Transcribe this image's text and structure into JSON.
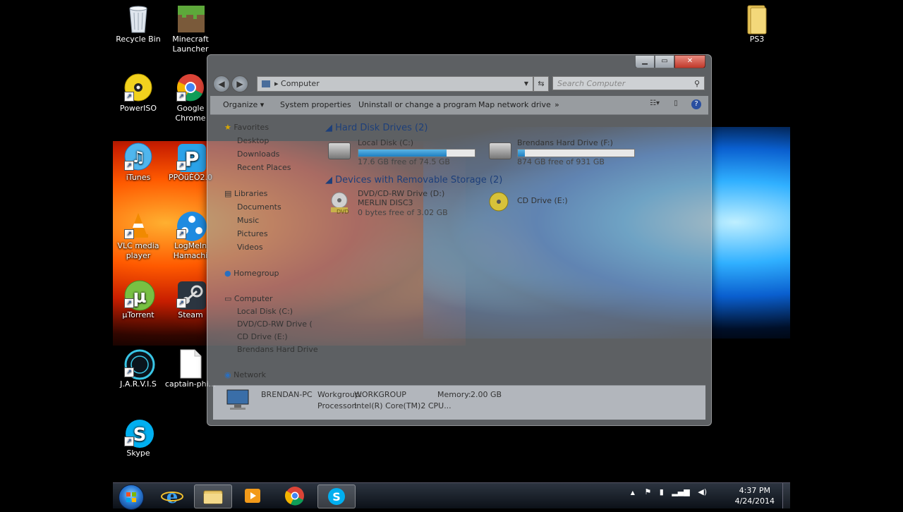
{
  "desktop": {
    "icons": [
      {
        "label": "Recycle Bin",
        "icon": "recycle-bin-icon"
      },
      {
        "label": "Minecraft Launcher",
        "icon": "minecraft-icon"
      },
      {
        "label": "PowerISO",
        "icon": "poweriso-icon"
      },
      {
        "label": "Google Chrome",
        "icon": "chrome-icon"
      },
      {
        "label": "iTunes",
        "icon": "itunes-icon"
      },
      {
        "label": "PPÒüÈÖ2.0",
        "icon": "pptv-icon"
      },
      {
        "label": "VLC media player",
        "icon": "vlc-icon"
      },
      {
        "label": "LogMeIn Hamachi",
        "icon": "hamachi-icon"
      },
      {
        "label": "µTorrent",
        "icon": "utorrent-icon"
      },
      {
        "label": "Steam",
        "icon": "steam-icon"
      },
      {
        "label": "J.A.R.V.I.S",
        "icon": "jarvis-icon"
      },
      {
        "label": "captain-phi...",
        "icon": "file-icon"
      },
      {
        "label": "Skype",
        "icon": "skype-icon"
      },
      {
        "label": "PS3",
        "icon": "folder-icon"
      }
    ]
  },
  "explorer": {
    "address": "Computer",
    "search_placeholder": "Search Computer",
    "toolbar": [
      "Organize",
      "System properties",
      "Uninstall or change a program",
      "Map network drive",
      "»"
    ],
    "nav": {
      "favorites": "Favorites",
      "favorites_items": [
        "Desktop",
        "Downloads",
        "Recent Places"
      ],
      "libraries": "Libraries",
      "libraries_items": [
        "Documents",
        "Music",
        "Pictures",
        "Videos"
      ],
      "homegroup": "Homegroup",
      "computer": "Computer",
      "computer_items": [
        "Local Disk (C:)",
        "DVD/CD-RW Drive (",
        "CD Drive (E:)",
        "Brendans Hard Drive"
      ],
      "network": "Network"
    },
    "hard_disk_group": "Hard Disk Drives (2)",
    "drives": [
      {
        "name": "Local Disk (C:)",
        "free": "17.6 GB free of 74.5 GB",
        "used_fraction": 0.76
      },
      {
        "name": "Brendans Hard Drive (F:)",
        "free": "874 GB free of 931 GB",
        "used_fraction": 0.06
      }
    ],
    "removable_group": "Devices with Removable Storage (2)",
    "removable": [
      {
        "name": "DVD/CD-RW Drive (D:)",
        "sub": "MERLIN DISC3",
        "free": "0 bytes free of 3.02 GB",
        "badge": "DVD"
      },
      {
        "name": "CD Drive (E:)"
      }
    ],
    "details": {
      "pc_name": "BRENDAN-PC",
      "workgroup_label": "Workgroup:",
      "workgroup": "WORKGROUP",
      "memory_label": "Memory:",
      "memory": "2.00 GB",
      "processor_label": "Processor:",
      "processor": "Intel(R) Core(TM)2 CPU..."
    }
  },
  "taskbar": {
    "time": "4:37 PM",
    "date": "4/24/2014",
    "tray_arrow": "▲"
  }
}
